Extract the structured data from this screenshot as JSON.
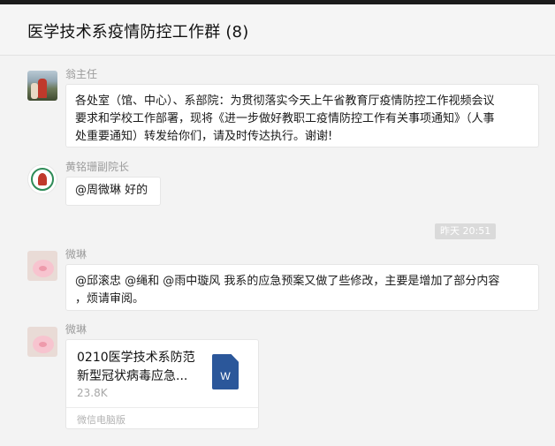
{
  "chat": {
    "title": "医学技术系疫情防控工作群 (8)"
  },
  "messages": [
    {
      "sender": "翁主任",
      "avatar": "person-photo",
      "lines": [
        "各处室（馆、中心）、系部院：为贯彻落实今天上午省教育厅疫情防控工作视频会议",
        "要求和学校工作部署，现将《进一步做好教职工疫情防控工作有关事项通知》（人事",
        "处重要通知）转发给你们，请及时传达执行。谢谢!"
      ]
    },
    {
      "sender": "黄铭珊副院长",
      "avatar": "school-logo",
      "lines": [
        "@周微琳 好的"
      ]
    },
    {
      "timestamp": "昨天 20:51"
    },
    {
      "sender": "微琳",
      "avatar": "pig-icon",
      "lines": [
        "@邱滚忠 @绳和 @雨中璇风 我系的应急预案又做了些修改，主要是增加了部分内容",
        "，烦请审阅。"
      ]
    },
    {
      "sender": "微琳",
      "avatar": "pig-icon",
      "file": {
        "name_line1": "0210医学技术系防范",
        "name_line2": "新型冠状病毒应急...",
        "size": "23.8K",
        "icon": "W",
        "source": "微信电脑版"
      }
    }
  ],
  "colors": {
    "word_blue": "#2b579a",
    "background": "#f3f3f3"
  }
}
